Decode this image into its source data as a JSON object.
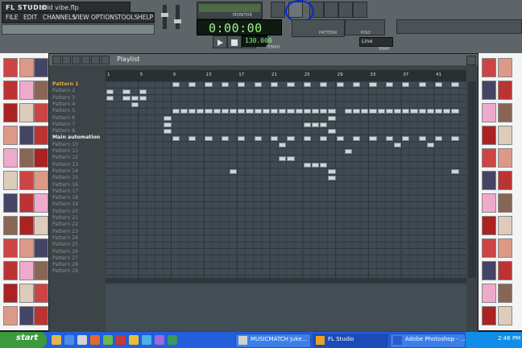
{
  "app": {
    "logo": "FL STUDIO",
    "filename": "cold vibe.flp"
  },
  "menu": [
    "FILE",
    "EDIT",
    "CHANNELS",
    "VIEW",
    "OPTIONS",
    "TOOLS",
    "HELP"
  ],
  "toolbar": {
    "monitor_label": "MONITOR",
    "time": "0:00:00",
    "tempo_label": "TEMPO",
    "tempo_value": "130.000",
    "pattern_label": "PATTERN",
    "poly_label": "POLY",
    "snap_label": "SNAP",
    "snap_value": "Line"
  },
  "playlist": {
    "title": "Playlist",
    "ruler": [
      "1",
      "5",
      "9",
      "13",
      "17",
      "21",
      "25",
      "29",
      "33",
      "37",
      "41"
    ],
    "patterns": [
      {
        "name": "Pattern 1",
        "color": "#e8a543"
      },
      {
        "name": "Pattern 2",
        "color": "#8a9196"
      },
      {
        "name": "Pattern 3",
        "color": "#8a9196"
      },
      {
        "name": "Pattern 4",
        "color": "#8a9196"
      },
      {
        "name": "Pattern 5",
        "color": "#8a9196"
      },
      {
        "name": "Pattern 6",
        "color": "#8a9196"
      },
      {
        "name": "Pattern 7",
        "color": "#8a9196"
      },
      {
        "name": "Pattern 8",
        "color": "#8a9196"
      },
      {
        "name": "Main automation",
        "color": "#f0f0f0"
      },
      {
        "name": "Pattern 10",
        "color": "#8a9196"
      },
      {
        "name": "Pattern 11",
        "color": "#8a9196"
      },
      {
        "name": "Pattern 12",
        "color": "#8a9196"
      },
      {
        "name": "Pattern 13",
        "color": "#8a9196"
      },
      {
        "name": "Pattern 14",
        "color": "#8a9196"
      },
      {
        "name": "Pattern 15",
        "color": "#8a9196"
      },
      {
        "name": "Pattern 16",
        "color": "#8a9196"
      },
      {
        "name": "Pattern 17",
        "color": "#8a9196"
      },
      {
        "name": "Pattern 18",
        "color": "#8a9196"
      },
      {
        "name": "Pattern 19",
        "color": "#8a9196"
      },
      {
        "name": "Pattern 20",
        "color": "#8a9196"
      },
      {
        "name": "Pattern 21",
        "color": "#8a9196"
      },
      {
        "name": "Pattern 22",
        "color": "#8a9196"
      },
      {
        "name": "Pattern 23",
        "color": "#8a9196"
      },
      {
        "name": "Pattern 24",
        "color": "#8a9196"
      },
      {
        "name": "Pattern 25",
        "color": "#8a9196"
      },
      {
        "name": "Pattern 26",
        "color": "#8a9196"
      },
      {
        "name": "Pattern 27",
        "color": "#8a9196"
      },
      {
        "name": "Pattern 28",
        "color": "#8a9196"
      },
      {
        "name": "Pattern 29",
        "color": "#8a9196"
      }
    ],
    "blocks": [
      {
        "row": 0,
        "bars": [
          9,
          11,
          13,
          15,
          17,
          19,
          21,
          23,
          25,
          27,
          29,
          31,
          33,
          35,
          37,
          39,
          41,
          43
        ]
      },
      {
        "row": 1,
        "bars": [
          1,
          3,
          5
        ]
      },
      {
        "row": 2,
        "bars": [
          1,
          3,
          4,
          5
        ]
      },
      {
        "row": 3,
        "bars": [
          4
        ]
      },
      {
        "row": 4,
        "bars": [
          9,
          10,
          11,
          12,
          13,
          14,
          15,
          16,
          17,
          18,
          19,
          20,
          21,
          22,
          23,
          24,
          25,
          26,
          27,
          28,
          30,
          31,
          32,
          33,
          34,
          35,
          36,
          37,
          38,
          39,
          40,
          41,
          42,
          43
        ]
      },
      {
        "row": 5,
        "bars": [
          8,
          28
        ]
      },
      {
        "row": 6,
        "bars": [
          8,
          25,
          26,
          27
        ]
      },
      {
        "row": 7,
        "bars": [
          8,
          28
        ]
      },
      {
        "row": 8,
        "bars": [
          9,
          11,
          13,
          15,
          17,
          19,
          21,
          23,
          25,
          27,
          29,
          31,
          33,
          35,
          37,
          39,
          41,
          43
        ]
      },
      {
        "row": 9,
        "bars": [
          22,
          36,
          40
        ]
      },
      {
        "row": 10,
        "bars": [
          30
        ]
      },
      {
        "row": 11,
        "bars": [
          22,
          23
        ]
      },
      {
        "row": 12,
        "bars": [
          25,
          26,
          27
        ]
      },
      {
        "row": 13,
        "bars": [
          16,
          28,
          43
        ]
      },
      {
        "row": 14,
        "bars": [
          28
        ]
      }
    ]
  },
  "taskbar": {
    "start": "start",
    "tasks": [
      {
        "label": "MUSICMATCH Juke...",
        "active": false
      },
      {
        "label": "FL Studio",
        "active": true
      },
      {
        "label": "Adobe Photoshop - ...",
        "active": false
      }
    ],
    "clock": "2:46 PM"
  }
}
